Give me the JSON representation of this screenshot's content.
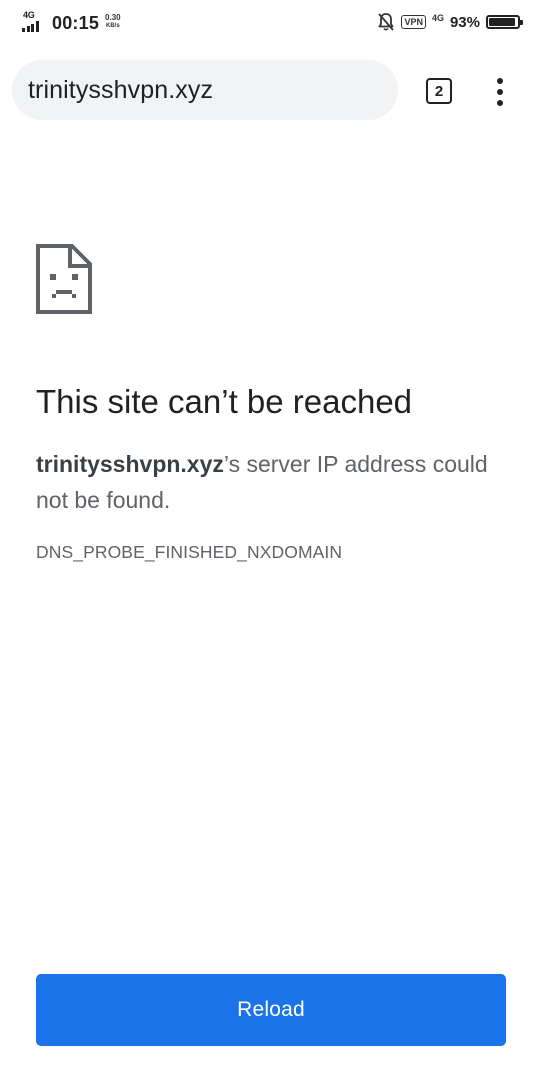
{
  "status_bar": {
    "network_left": "4G",
    "time": "00:15",
    "speed_value": "0.30",
    "speed_unit": "KB/s",
    "vpn_label": "VPN",
    "network_right": "4G",
    "battery_percent": "93%",
    "battery_level": 0.93,
    "icons": [
      "signal-icon",
      "bell-off-icon",
      "battery-icon"
    ]
  },
  "toolbar": {
    "url": "trinitysshvpn.xyz",
    "tab_count": "2",
    "icons": [
      "tab-switcher-icon",
      "more-vertical-icon"
    ]
  },
  "error": {
    "icon": "sad-page-icon",
    "title": "This site can’t be reached",
    "host": "trinitysshvpn.xyz",
    "message_rest": "’s server IP address could not be found.",
    "code": "DNS_PROBE_FINISHED_NXDOMAIN"
  },
  "actions": {
    "reload_label": "Reload"
  },
  "colors": {
    "accent": "#1a73e8",
    "omnibox_bg": "#f1f3f4",
    "text_primary": "#202124",
    "text_secondary": "#5f6368"
  }
}
